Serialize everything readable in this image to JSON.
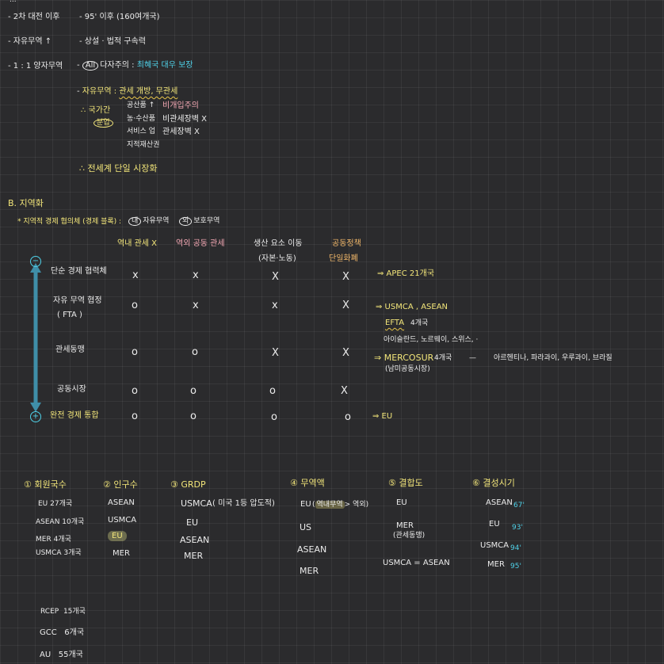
{
  "top_notes": {
    "cut_title": "...",
    "item1_label": "- 2차 대전 이후",
    "item1_note": "- 95' 이후 (160여개국)",
    "item2_label": "- 자유무역 ↑",
    "item2_note": "- 상설 · 법적 구속력",
    "item3_label": "- 1 : 1 양자무역",
    "item3_dash": "-",
    "item3_circle": "All",
    "item3_text": "다자주의 :",
    "item3_note": "최혜국 대우 보장",
    "item4_dash": "-",
    "item4_label": "자유무역 :",
    "item4_note": "관세 개방, 무관세",
    "therefore1": "∴ 국가간",
    "therefore1_circle": "분업",
    "list_goods": [
      "공산품 ↑",
      "농·수산품",
      "서비스 업",
      "지적재산권"
    ],
    "list_status": [
      "비개입주의",
      "비관세장벽 X",
      "관세장벽 X"
    ],
    "therefore2": "∴ 전세계 단일 시장화"
  },
  "section_b": {
    "title": "B. 지역화",
    "subtitle": "* 지역적 경제 협의체 (경제 블록) :",
    "legend_in_circle": "내",
    "legend_in_text": "자유무역",
    "legend_out_circle": "외",
    "legend_out_text": "보호무역"
  },
  "matrix": {
    "columns": [
      "역내 관세 X",
      "역외 공동 관세",
      "생산 요소 이동",
      "공동정책"
    ],
    "column_subs": [
      "",
      "",
      "(자본·노동)",
      "단일화폐"
    ],
    "axis_top": "−",
    "axis_bottom": "+",
    "rows": [
      {
        "label": "단순 경제 협력체",
        "sub": "",
        "cells": [
          "x",
          "x",
          "X",
          "X"
        ],
        "arrow": "⇒ APEC 21개국"
      },
      {
        "label": "자유 무역 협정",
        "sub": "( FTA )",
        "cells": [
          "o",
          "x",
          "x",
          "X"
        ],
        "arrow": "⇒ USMCA , ASEAN"
      },
      {
        "label": "관세동맹",
        "sub": "",
        "cells": [
          "o",
          "o",
          "X",
          "X"
        ],
        "arrow": "⇒ MERCOSUR"
      },
      {
        "label": "공동시장",
        "sub": "",
        "cells": [
          "o",
          "o",
          "o",
          "X"
        ],
        "arrow": ""
      },
      {
        "label": "완전 경제 통합",
        "sub": "",
        "cells": [
          "o",
          "o",
          "o",
          "o"
        ],
        "arrow": "⇒ EU"
      }
    ],
    "efta": "EFTA",
    "efta_count": "4개국",
    "efta_members": "아이슬란드, 노르웨이, 스위스, ·",
    "mercosur_count": "4개국",
    "mercosur_dash": "—",
    "mercosur_members": "아르헨티나, 파라과이, 우루과이, 브라질",
    "mercosur_sub": "(남미공동시장)"
  },
  "rankings": [
    {
      "title": "① 회원국수",
      "items": [
        "EU 27개국",
        "ASEAN 10개국",
        "MER 4개국",
        "USMCA 3개국"
      ]
    },
    {
      "title": "② 인구수",
      "items": [
        "ASEAN",
        "USMCA",
        "EU",
        "MER"
      ]
    },
    {
      "title": "③ GRDP",
      "items": [
        "USMCA",
        "EU",
        "ASEAN",
        "MER"
      ],
      "note": "( 미국 1등 압도적)"
    },
    {
      "title": "④ 무역액",
      "items": [
        "EU",
        "US",
        "ASEAN",
        "MER"
      ],
      "note_open": "(",
      "note_hl": "역내무역",
      "note_close": "> 역외)"
    },
    {
      "title": "⑤ 결합도",
      "items": [
        "EU",
        "MER",
        "USMCA = ASEAN"
      ],
      "mer_sub": "(관세동맹)"
    },
    {
      "title": "⑥ 결성시기",
      "items": [
        "ASEAN",
        "EU",
        "USMCA",
        "MER"
      ],
      "years": [
        "67'",
        "93'",
        "94'",
        "95'"
      ]
    }
  ],
  "others": [
    {
      "name": "RCEP",
      "count": "15개국"
    },
    {
      "name": "GCC",
      "count": "6개국"
    },
    {
      "name": "AU",
      "count": "55개국"
    }
  ],
  "colors": {
    "background": "#2b2b2d",
    "text": "#ececec",
    "yellow": "#f3e67a",
    "cyan": "#4fd1e8",
    "pink": "#f4a8b4",
    "orange": "#f2b86a",
    "axis": "#3f8ea8"
  }
}
